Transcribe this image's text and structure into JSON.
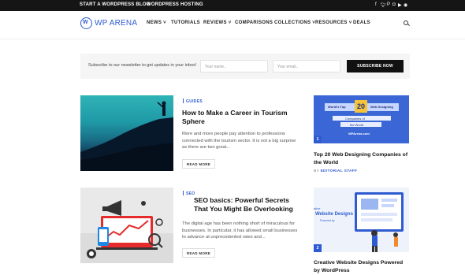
{
  "topbar": {
    "links": [
      "START A WORDPRESS BLOG",
      "WORDPRESS HOSTING"
    ],
    "social_icons": [
      "facebook-icon",
      "twitter-icon",
      "pinterest-icon",
      "instagram-icon",
      "youtube-icon",
      "rss-icon"
    ]
  },
  "header": {
    "logo_text": "WP ARENA",
    "nav": [
      {
        "label": "NEWS",
        "has_dropdown": true
      },
      {
        "label": "TUTORIALS",
        "has_dropdown": false
      },
      {
        "label": "REVIEWS",
        "has_dropdown": true
      },
      {
        "label": "COMPARISONS",
        "has_dropdown": false
      },
      {
        "label": "COLLECTIONS",
        "has_dropdown": true
      },
      {
        "label": "RESOURCES",
        "has_dropdown": true
      },
      {
        "label": "DEALS",
        "has_dropdown": false
      }
    ]
  },
  "newsletter": {
    "text": "Subscribe to our newsletter to get updates in your inbox!",
    "name_placeholder": "Your name..",
    "email_placeholder": "Your email..",
    "button_label": "SUBSCRIBE NOW"
  },
  "articles": [
    {
      "category": "GUIDES",
      "title": "How to Make a Career in Tourism Sphere",
      "excerpt": "More and more people pay attention to professions connected with the tourism sector. It is not a big surprise as there are two great...",
      "read_more": "READ MORE"
    },
    {
      "category": "SEO",
      "title": "SEO basics: Powerful Secrets That You Might Be Overlooking",
      "excerpt": "The digital age has been nothing short of miraculous for businesses. In particular, it has allowed small businesses to advance at unprecedented rates and...",
      "read_more": "READ MORE"
    }
  ],
  "sidebar": [
    {
      "number": "1",
      "title": "Top 20 Web Designing Companies of the World",
      "meta_by": "BY",
      "author": "EDITORIAL STAFF",
      "image_text": {
        "a": "World's Top",
        "b": "20",
        "c": "Web Designing",
        "d": "Companies of",
        "e": "the World",
        "f": "WPArena.com"
      }
    },
    {
      "number": "2",
      "title": "Creative Website Designs Powered by WordPress",
      "image_text": {
        "a": "ative",
        "b": "Website Designs",
        "c": "Powered by"
      }
    }
  ],
  "colors": {
    "accent": "#2f5bd1",
    "topbar": "#151515",
    "button": "#111111"
  }
}
